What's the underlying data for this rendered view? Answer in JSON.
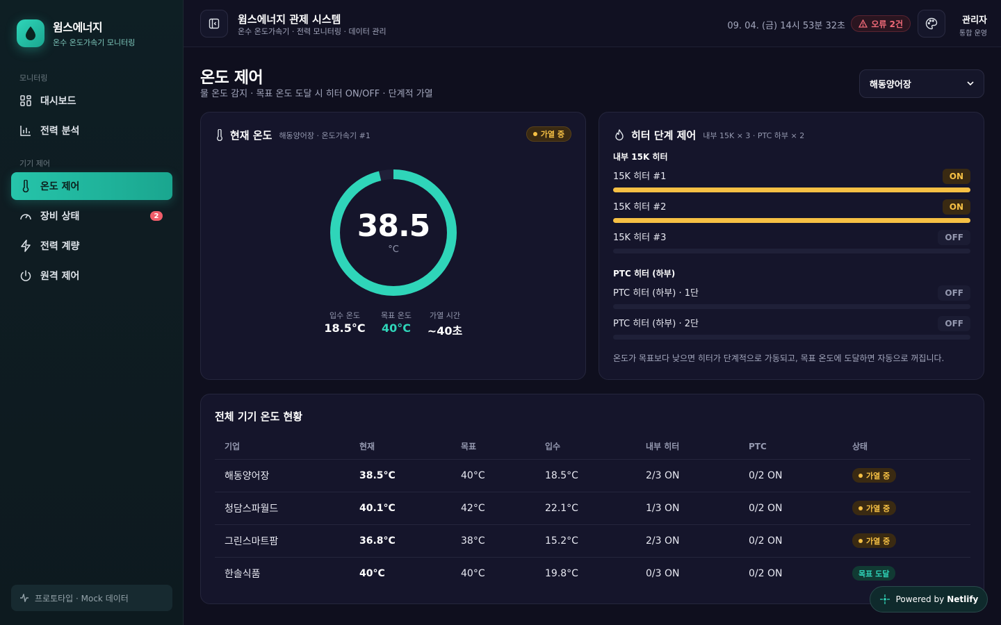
{
  "brand": {
    "title": "윔스에너지",
    "subtitle": "온수 온도가속기 모니터링"
  },
  "sidebar": {
    "section_monitoring": "모니터링",
    "section_control": "기기 제어",
    "items": [
      {
        "label": "대시보드",
        "icon": "grid-icon"
      },
      {
        "label": "전력 분석",
        "icon": "bar-chart-icon"
      },
      {
        "label": "온도 제어",
        "icon": "thermometer-icon",
        "active": true
      },
      {
        "label": "장비 상태",
        "icon": "gauge-icon",
        "badge": "2"
      },
      {
        "label": "전력 계량",
        "icon": "lightning-icon"
      },
      {
        "label": "원격 제어",
        "icon": "power-icon"
      }
    ],
    "footer": "프로토타입 · Mock 데이터"
  },
  "header": {
    "title": "윔스에너지 관제 시스템",
    "subtitle": "온수 온도가속기 · 전력 모니터링 · 데이터 관리",
    "datetime": "09. 04. (금) 14시 53분 32초",
    "error_badge": "오류 2건",
    "user_name": "관리자",
    "user_role": "통합 운영"
  },
  "page": {
    "title": "온도 제어",
    "subtitle": "물 온도 감지 · 목표 온도 도달 시 히터 ON/OFF · 단계적 가열",
    "site_select": "해동양어장"
  },
  "temp_card": {
    "title": "현재 온도",
    "meta": "해동양어장 · 온도가속기 #1",
    "badge": "가열 중",
    "current": "38.5",
    "unit": "°C",
    "gauge_fraction": 0.9625,
    "stats": [
      {
        "label": "입수 온도",
        "value": "18.5°C"
      },
      {
        "label": "목표 온도",
        "value": "40°C"
      },
      {
        "label": "가열 시간",
        "value": "~40초"
      }
    ]
  },
  "heater_card": {
    "title": "히터 단계 제어",
    "meta": "내부 15K × 3 · PTC 하부 × 2",
    "group_internal": "내부 15K 히터",
    "group_ptc": "PTC 히터 (하부)",
    "internal": [
      {
        "name": "15K 히터 #1",
        "state": "ON",
        "level": 1
      },
      {
        "name": "15K 히터 #2",
        "state": "ON",
        "level": 1
      },
      {
        "name": "15K 히터 #3",
        "state": "OFF",
        "level": 0
      }
    ],
    "ptc": [
      {
        "name": "PTC 히터 (하부) · 1단",
        "state": "OFF",
        "level": 0
      },
      {
        "name": "PTC 히터 (하부) · 2단",
        "state": "OFF",
        "level": 0
      }
    ],
    "note": "온도가 목표보다 낮으면 히터가 단계적으로 가동되고, 목표 온도에 도달하면 자동으로 꺼집니다."
  },
  "table": {
    "title": "전체 기기 온도 현황",
    "columns": [
      "기업",
      "현재",
      "목표",
      "입수",
      "내부 히터",
      "PTC",
      "상태"
    ],
    "rows": [
      [
        "해동양어장",
        "38.5°C",
        "40°C",
        "18.5°C",
        "2/3 ON",
        "0/2 ON",
        "가열 중"
      ],
      [
        "청담스파월드",
        "40.1°C",
        "42°C",
        "22.1°C",
        "1/3 ON",
        "0/2 ON",
        "가열 중"
      ],
      [
        "그린스마트팜",
        "36.8°C",
        "38°C",
        "15.2°C",
        "2/3 ON",
        "0/2 ON",
        "가열 중"
      ],
      [
        "한솔식품",
        "40°C",
        "40°C",
        "19.8°C",
        "0/3 ON",
        "0/2 ON",
        "목표 도달"
      ]
    ]
  },
  "netlify": {
    "prefix": "Powered by",
    "brand": "Netlify"
  },
  "colors": {
    "accent": "#2fd5b9",
    "warning": "#f6c044",
    "danger": "#f06a78",
    "background": "#0f0f1e"
  }
}
